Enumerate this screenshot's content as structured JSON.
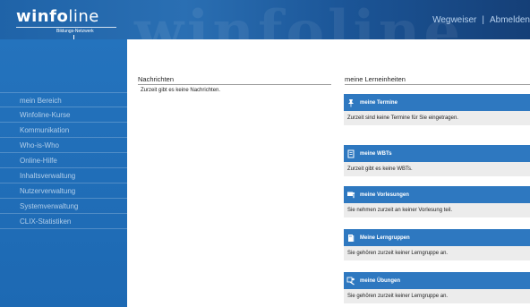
{
  "header": {
    "logo_bold": "winfo",
    "logo_light": "line",
    "logo_tagline": "Bildungs-Netzwerk",
    "watermark": "winfoline",
    "links": [
      "Wegweiser",
      "Abmelden"
    ],
    "separator": "|"
  },
  "nav": {
    "items": [
      "mein Bereich",
      "Winfoline-Kurse",
      "Kommunikation",
      "Who-is-Who",
      "Online-Hilfe",
      "Inhaltsverwaltung",
      "Nutzerverwaltung",
      "Systemverwaltung",
      "CLIX-Statistiken"
    ]
  },
  "news": {
    "title": "Nachrichten",
    "message": "Zurzeit gibt es keine Nachrichten."
  },
  "learning_units": {
    "title": "meine Lerneinheiten",
    "sections": [
      {
        "icon": "pin-icon",
        "label": "meine Termine",
        "text": "Zurzeit sind keine Termine für Sie eingetragen."
      },
      {
        "icon": "document-icon",
        "label": "meine WBTs",
        "text": "Zurzeit gibt es keine WBTs."
      },
      {
        "icon": "presentation-icon",
        "label": "meine Vorlesungen",
        "text": "Sie nehmen zurzeit an keiner Vorlesung teil."
      },
      {
        "icon": "book-icon",
        "label": "Meine Lerngruppen",
        "text": "Sie gehören zurzeit keiner Lerngruppe an."
      },
      {
        "icon": "exercise-icon",
        "label": "meine Übungen",
        "text": "Sie gehören zurzeit keiner Lerngruppe an."
      }
    ]
  },
  "colors": {
    "header_blue": "#1f63a8",
    "sidebar_blue": "#2473bd",
    "section_blue": "#2e78c0",
    "section_body": "#ececec"
  }
}
